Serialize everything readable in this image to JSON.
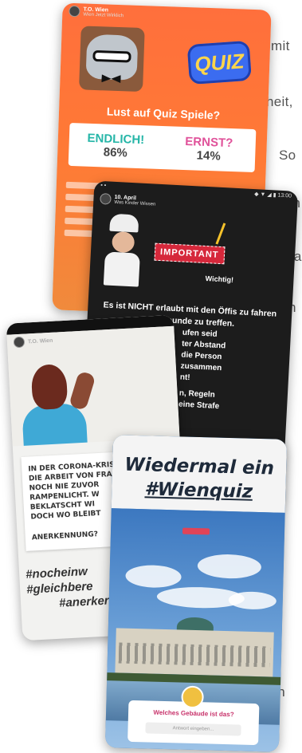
{
  "background_text": {
    "line1": "t mit",
    "line2": "heit,",
    "line3": "So",
    "line4": "gen",
    "line5": "sta-",
    "line6": "n",
    "line7": "auch"
  },
  "story_quiz": {
    "username": "T.O. Wien",
    "time": "",
    "sub": "Wien Jetzt Wirklich",
    "logo": "QUIZ",
    "question": "Lust auf Quiz Spiele?",
    "options": [
      {
        "label": "ENDLICH!",
        "percent": "86%",
        "color": "#26b6a8"
      },
      {
        "label": "ERNST?",
        "percent": "14%",
        "color": "#e0529a"
      }
    ]
  },
  "story_important": {
    "username": "T.O. Wien",
    "time": "10. April",
    "sub": "Was Kinder Wissen",
    "label": "IMPORTANT",
    "subtitle": "Wichtig!",
    "body": "Es ist NICHT erlaubt mit den Öffis zu fahren um Freunde zu treffen.",
    "body2": [
      "ufen seid",
      "ter Abstand",
      "die Person",
      "zusammen",
      "nt!",
      "n, Regeln",
      "eine Strafe"
    ]
  },
  "story_corona": {
    "username": "T.O. Wien",
    "lines": [
      "IN DER CORONA-KRISE RÜCKT",
      "DIE ARBEIT VON FRAUEN",
      "NOCH NIE ZUVOR",
      "RAMPENLICHT. W",
      "BEKLATSCHT WI",
      "DOCH WO BLEIBT"
    ],
    "anerkennung": "ANERKENNUNG?",
    "hashtags": [
      "#nocheinw",
      "#gleichbere",
      "#anerker"
    ]
  },
  "story_wien": {
    "username": "T.O. Wien",
    "title_line1": "Wiedermal ein",
    "title_line2": "#Wienquiz",
    "poll_question": "Welches Gebäude ist das?",
    "poll_placeholder": "Antwort eingeben..."
  },
  "colors": {
    "quiz_bg": "#ff6f3c",
    "important_bg": "#1c1c1c",
    "important_label": "#d6283b",
    "wien_title": "#1e2a3a",
    "poll_accent": "#c8336b"
  }
}
